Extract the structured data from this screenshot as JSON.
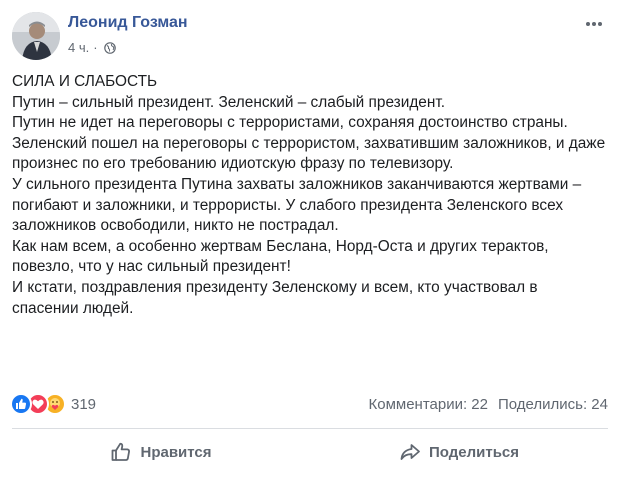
{
  "post": {
    "author": "Леонид Гозман",
    "time": "4 ч.",
    "separator": "·",
    "paragraphs": [
      "СИЛА И СЛАБОСТЬ",
      "Путин – сильный президент. Зеленский – слабый президент.",
      "Путин не идет на переговоры с террористами, сохраняя достоинство страны. Зеленский пошел на переговоры с террористом, захватившим заложников, и даже произнес по его требованию идиотскую фразу по телевизору.",
      "У сильного президента Путина захваты заложников заканчиваются жертвами – погибают и заложники, и террористы. У слабого президента Зеленского всех заложников освободили, никто не пострадал.",
      "Как нам всем, а особенно жертвам Беслана, Норд-Оста и других терактов, повезло, что у нас сильный президент!",
      "И кстати, поздравления президенту Зеленскому и всем, кто участвовал в спасении людей."
    ]
  },
  "stats": {
    "reactions_count": "319",
    "comments": "Комментарии: 22",
    "shares": "Поделились: 24"
  },
  "actions": {
    "like": "Нравится",
    "share": "Поделиться"
  },
  "colors": {
    "author": "#385898",
    "meta": "#606770",
    "like_reaction": "#1877f2",
    "love_reaction": "#f33e58",
    "care_reaction": "#f7b125"
  },
  "icons": {
    "avatar": "avatar-photo",
    "privacy": "globe-icon",
    "menu": "more-icon",
    "like_action": "thumbs-up-icon",
    "share_action": "share-arrow-icon"
  }
}
